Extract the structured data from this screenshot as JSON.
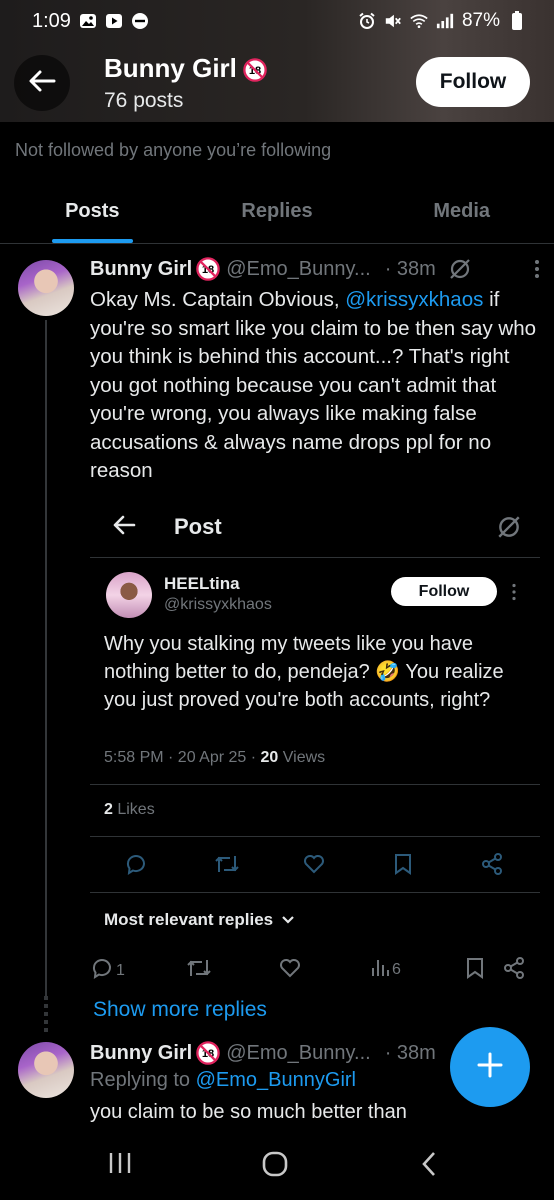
{
  "status_bar": {
    "time": "1:09",
    "battery": "87%"
  },
  "profile": {
    "name": "Bunny Girl",
    "posts_count": "76 posts",
    "follow_label": "Follow",
    "not_followed_text": "Not followed by anyone you’re following"
  },
  "tabs": [
    {
      "label": "Posts",
      "active": true
    },
    {
      "label": "Replies",
      "active": false
    },
    {
      "label": "Media",
      "active": false
    }
  ],
  "tweet1": {
    "name": "Bunny Girl",
    "handle": "@Emo_Bunny...",
    "time": "· 38m",
    "text_before": "Okay Ms. Captain Obvious, ",
    "mention": "@krissyxkhaos",
    "text_after": " if you're so smart like you claim to be then say who you think is behind this account...? That's right you got nothing because you can't admit that you're wrong, you always like making false accusations & always name drops ppl for no reason",
    "actions": {
      "replies": "1",
      "views": "6"
    }
  },
  "embedded_post": {
    "header_title": "Post",
    "author_name": "HEELtina",
    "author_handle": "@krissyxkhaos",
    "follow_label": "Follow",
    "text": "Why you stalking my tweets like you have nothing better to do, pendeja? 🤣 You realize you just proved you're both accounts, right?",
    "meta": "5:58 PM · 20 Apr 25 · ",
    "views_count": "20",
    "views_label": " Views",
    "likes_count": "2",
    "likes_label": " Likes",
    "most_relevant": "Most relevant replies"
  },
  "show_more": "Show more replies",
  "tweet2": {
    "name": "Bunny Girl",
    "handle": "@Emo_Bunny...",
    "time": "· 38m",
    "replying_prefix": "Replying to ",
    "replying_to": "@Emo_BunnyGirl",
    "text": "you claim to be so much better than"
  },
  "colors": {
    "accent": "#1d9bf0",
    "background": "#000000",
    "muted": "#71767b",
    "text": "#e7e9ea"
  },
  "icons": [
    "back-arrow-icon",
    "age-18-icon",
    "grok-icon",
    "more-icon",
    "reply-icon",
    "retweet-icon",
    "like-icon",
    "views-icon",
    "bookmark-icon",
    "share-icon",
    "plus-icon",
    "recents-icon",
    "home-icon",
    "back-icon"
  ]
}
